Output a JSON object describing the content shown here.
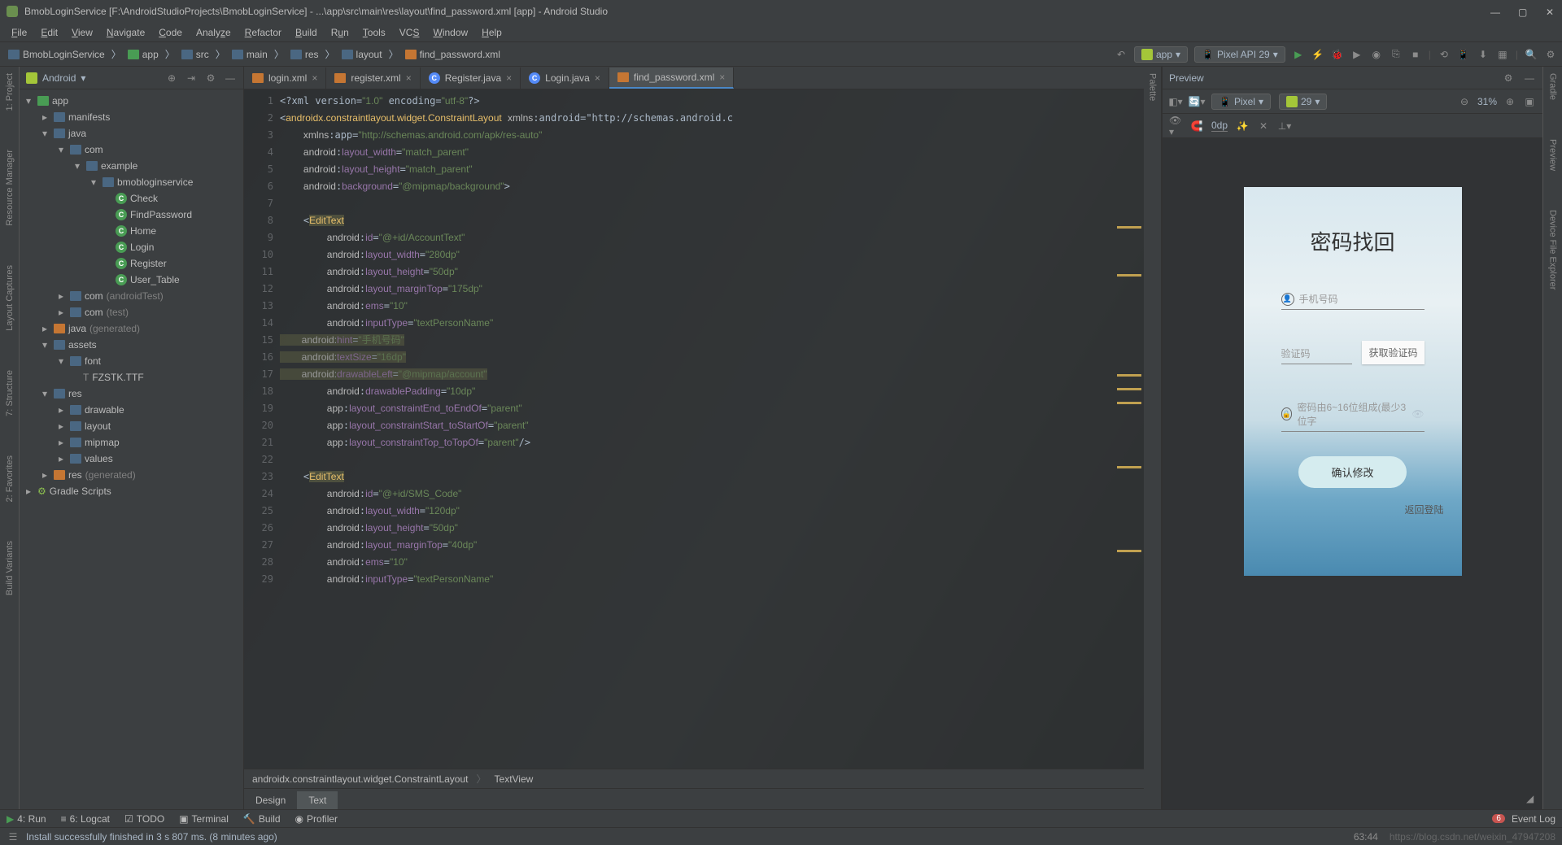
{
  "window": {
    "title": "BmobLoginService [F:\\AndroidStudioProjects\\BmobLoginService] - ...\\app\\src\\main\\res\\layout\\find_password.xml [app] - Android Studio"
  },
  "menus": [
    "File",
    "Edit",
    "View",
    "Navigate",
    "Code",
    "Analyze",
    "Refactor",
    "Build",
    "Run",
    "Tools",
    "VCS",
    "Window",
    "Help"
  ],
  "breadcrumbs": [
    "BmobLoginService",
    "app",
    "src",
    "main",
    "res",
    "layout",
    "find_password.xml"
  ],
  "runTarget": {
    "module": "app",
    "avd": "Pixel API 29"
  },
  "projectPanel": {
    "viewMode": "Android"
  },
  "tree": {
    "app": "app",
    "manifests": "manifests",
    "java": "java",
    "com": "com",
    "example": "example",
    "bmob": "bmobloginservice",
    "classes": [
      "Check",
      "FindPassword",
      "Home",
      "Login",
      "Register",
      "User_Table"
    ],
    "comAndroidTest": "com",
    "atlabel": "(androidTest)",
    "comTest": "com",
    "testlabel": "(test)",
    "javaGen": "java",
    "genlabel": "(generated)",
    "assets": "assets",
    "font": "font",
    "fzstk": "FZSTK.TTF",
    "res": "res",
    "drawable": "drawable",
    "layout": "layout",
    "mipmap": "mipmap",
    "values": "values",
    "resGen": "res",
    "resGenLabel": "(generated)",
    "gradle": "Gradle Scripts"
  },
  "tabs": [
    {
      "name": "login.xml",
      "icon": "xml"
    },
    {
      "name": "register.xml",
      "icon": "xml"
    },
    {
      "name": "Register.java",
      "icon": "class"
    },
    {
      "name": "Login.java",
      "icon": "class"
    },
    {
      "name": "find_password.xml",
      "icon": "xml",
      "active": true
    }
  ],
  "code": {
    "lines": [
      "<?xml version=\"1.0\" encoding=\"utf-8\"?>",
      "<androidx.constraintlayout.widget.ConstraintLayout xmlns:android=\"http://schemas.android.c",
      "    xmlns:app=\"http://schemas.android.com/apk/res-auto\"",
      "    android:layout_width=\"match_parent\"",
      "    android:layout_height=\"match_parent\"",
      "    android:background=\"@mipmap/background\">",
      "",
      "    <EditText",
      "        android:id=\"@+id/AccountText\"",
      "        android:layout_width=\"280dp\"",
      "        android:layout_height=\"50dp\"",
      "        android:layout_marginTop=\"175dp\"",
      "        android:ems=\"10\"",
      "        android:inputType=\"textPersonName\"",
      "        android:hint=\"手机号码\"",
      "        android:textSize=\"16dp\"",
      "        android:drawableLeft=\"@mipmap/account\"",
      "        android:drawablePadding=\"10dp\"",
      "        app:layout_constraintEnd_toEndOf=\"parent\"",
      "        app:layout_constraintStart_toStartOf=\"parent\"",
      "        app:layout_constraintTop_toTopOf=\"parent\"/>",
      "",
      "    <EditText",
      "        android:id=\"@+id/SMS_Code\"",
      "        android:layout_width=\"120dp\"",
      "        android:layout_height=\"50dp\"",
      "        android:layout_marginTop=\"40dp\"",
      "        android:ems=\"10\"",
      "        android:inputType=\"textPersonName\""
    ]
  },
  "editorBreadcrumb": {
    "root": "androidx.constraintlayout.widget.ConstraintLayout",
    "leaf": "TextView"
  },
  "designTabs": {
    "design": "Design",
    "text": "Text"
  },
  "preview": {
    "title": "Preview",
    "device": "Pixel",
    "api": "29",
    "zoom": "31%",
    "dp": "0dp",
    "phone": {
      "title": "密码找回",
      "phoneHint": "手机号码",
      "codeHint": "验证码",
      "getCode": "获取验证码",
      "pwdHint": "密码由6~16位组成(最少3位字",
      "confirm": "确认修改",
      "back": "返回登陆"
    }
  },
  "bottomTabs": {
    "run": "4: Run",
    "logcat": "6: Logcat",
    "todo": "TODO",
    "terminal": "Terminal",
    "build": "Build",
    "profiler": "Profiler",
    "eventlog": "Event Log",
    "eventCount": "6"
  },
  "status": {
    "msg": "Install successfully finished in 3 s 807 ms. (8 minutes ago)",
    "pos": "63:44",
    "watermark": "https://blog.csdn.net/weixin_47947208"
  }
}
